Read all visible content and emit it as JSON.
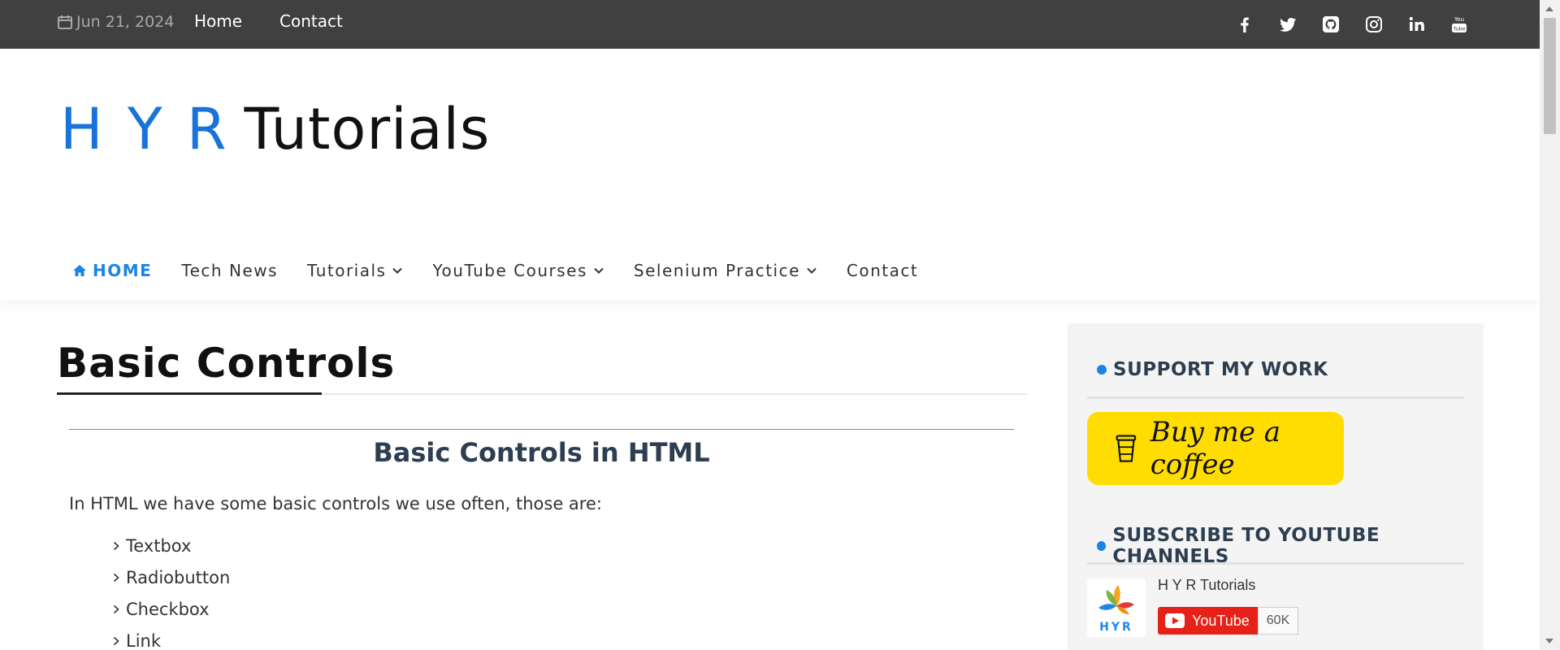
{
  "topbar": {
    "date": "Jun 21, 2024",
    "links": [
      "Home",
      "Contact"
    ],
    "social_icons": [
      "facebook-icon",
      "twitter-icon",
      "github-icon",
      "instagram-icon",
      "linkedin-icon",
      "youtube-icon"
    ]
  },
  "logo": {
    "part1": "H Y R",
    "part2": "Tutorials"
  },
  "nav": {
    "items": [
      {
        "label": "HOME",
        "active": true,
        "dropdown": false
      },
      {
        "label": "Tech News",
        "active": false,
        "dropdown": false
      },
      {
        "label": "Tutorials",
        "active": false,
        "dropdown": true
      },
      {
        "label": "YouTube Courses",
        "active": false,
        "dropdown": true
      },
      {
        "label": "Selenium Practice",
        "active": false,
        "dropdown": true
      },
      {
        "label": "Contact",
        "active": false,
        "dropdown": false
      }
    ]
  },
  "content": {
    "page_title": "Basic Controls",
    "subtitle": "Basic Controls in HTML",
    "intro": "In HTML we have some basic controls we use often, those are:",
    "controls": [
      "Textbox",
      "Radiobutton",
      "Checkbox",
      "Link"
    ]
  },
  "sidebar": {
    "support_title": "SUPPORT MY WORK",
    "coffee_label": "Buy me a coffee",
    "subscribe_title": "SUBSCRIBE TO YOUTUBE CHANNELS",
    "channel_name": "H Y R Tutorials",
    "youtube_label": "YouTube",
    "subscriber_count": "60K",
    "logo_text": "HYR"
  },
  "colors": {
    "topbar_bg": "#404040",
    "accent": "#1a85e5",
    "coffee_yellow": "#ffdd00",
    "youtube_red": "#e62117"
  }
}
